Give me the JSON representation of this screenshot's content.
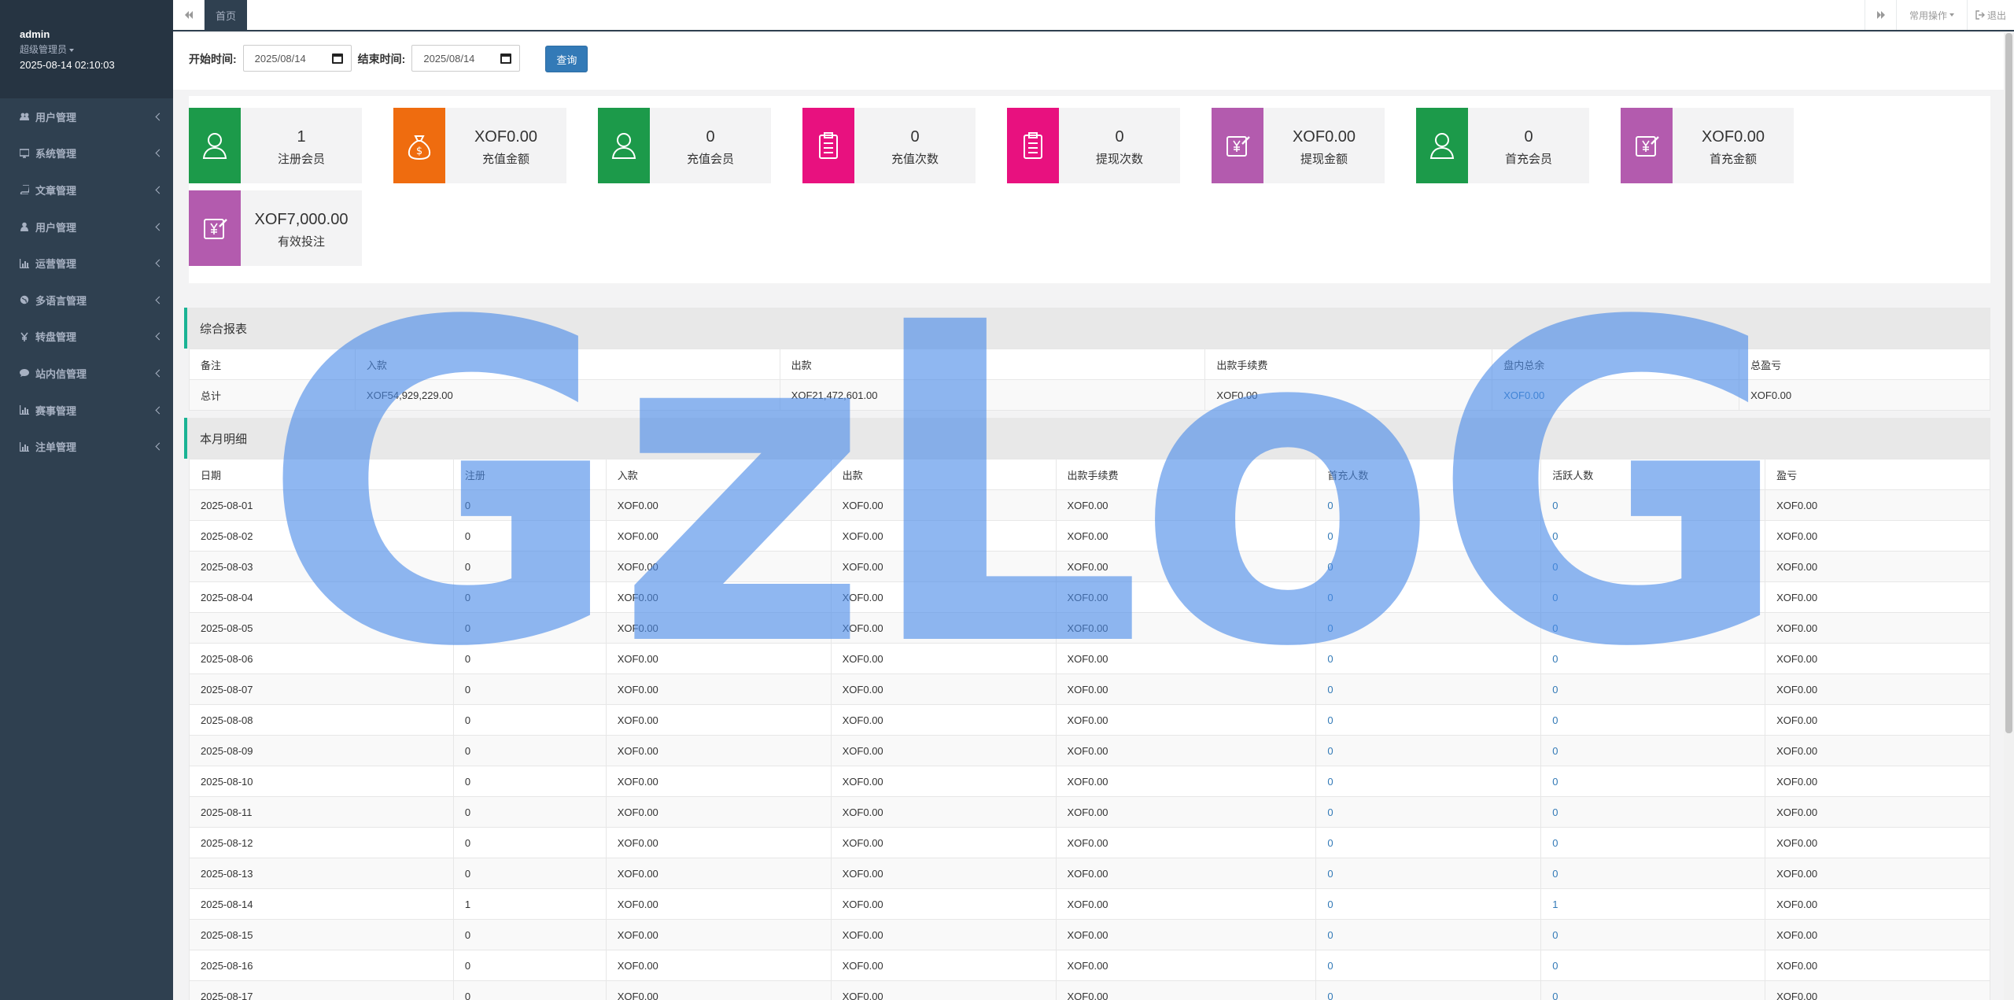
{
  "sidebar": {
    "username": "admin",
    "role": "超级管理员",
    "datetime": "2025-08-14 02:10:03",
    "items": [
      {
        "label": "用户管理",
        "icon": "users-icon"
      },
      {
        "label": "系统管理",
        "icon": "desktop-icon"
      },
      {
        "label": "文章管理",
        "icon": "book-icon"
      },
      {
        "label": "用户管理",
        "icon": "user-icon"
      },
      {
        "label": "运营管理",
        "icon": "bar-chart-icon"
      },
      {
        "label": "多语言管理",
        "icon": "globe-icon"
      },
      {
        "label": "转盘管理",
        "icon": "yen-icon"
      },
      {
        "label": "站内信管理",
        "icon": "comment-icon"
      },
      {
        "label": "赛事管理",
        "icon": "bar-chart-icon"
      },
      {
        "label": "注单管理",
        "icon": "bar-chart-icon"
      }
    ]
  },
  "topbar": {
    "tab_home": "首页",
    "common_ops": "常用操作",
    "logout": "退出"
  },
  "filter": {
    "start_label": "开始时间:",
    "start_value": "2025/08/14",
    "end_label": "结束时间:",
    "end_value": "2025/08/14",
    "query_button": "查询"
  },
  "cards": [
    {
      "value": "1",
      "label": "注册会员",
      "color": "#1c9a4a",
      "icon": "user-icon"
    },
    {
      "value": "XOF0.00",
      "label": "充值金额",
      "color": "#ef6c0f",
      "icon": "money-bag-icon"
    },
    {
      "value": "0",
      "label": "充值会员",
      "color": "#1c9a4a",
      "icon": "user-icon"
    },
    {
      "value": "0",
      "label": "充值次数",
      "color": "#e8117f",
      "icon": "clipboard-icon"
    },
    {
      "value": "0",
      "label": "提现次数",
      "color": "#e8117f",
      "icon": "clipboard-icon"
    },
    {
      "value": "XOF0.00",
      "label": "提现金额",
      "color": "#b35bae",
      "icon": "yen-edit-icon"
    },
    {
      "value": "0",
      "label": "首充会员",
      "color": "#1c9a4a",
      "icon": "user-icon"
    },
    {
      "value": "XOF0.00",
      "label": "首充金额",
      "color": "#b35bae",
      "icon": "yen-edit-icon"
    },
    {
      "value": "XOF7,000.00",
      "label": "有效投注",
      "color": "#b35bae",
      "icon": "yen-edit-icon"
    }
  ],
  "summary": {
    "title": "综合报表",
    "headers": [
      "备注",
      "入款",
      "出款",
      "出款手续费",
      "盘内总余",
      "总盈亏"
    ],
    "row": [
      "总计",
      "XOF54,929,229.00",
      "XOF21,472,601.00",
      "XOF0.00",
      "XOF0.00",
      "XOF0.00"
    ]
  },
  "monthly": {
    "title": "本月明细",
    "headers": [
      "日期",
      "注册",
      "入款",
      "出款",
      "出款手续费",
      "首充人数",
      "活跃人数",
      "盈亏"
    ],
    "rows": [
      [
        "2025-08-01",
        "0",
        "XOF0.00",
        "XOF0.00",
        "XOF0.00",
        "0",
        "0",
        "XOF0.00"
      ],
      [
        "2025-08-02",
        "0",
        "XOF0.00",
        "XOF0.00",
        "XOF0.00",
        "0",
        "0",
        "XOF0.00"
      ],
      [
        "2025-08-03",
        "0",
        "XOF0.00",
        "XOF0.00",
        "XOF0.00",
        "0",
        "0",
        "XOF0.00"
      ],
      [
        "2025-08-04",
        "0",
        "XOF0.00",
        "XOF0.00",
        "XOF0.00",
        "0",
        "0",
        "XOF0.00"
      ],
      [
        "2025-08-05",
        "0",
        "XOF0.00",
        "XOF0.00",
        "XOF0.00",
        "0",
        "0",
        "XOF0.00"
      ],
      [
        "2025-08-06",
        "0",
        "XOF0.00",
        "XOF0.00",
        "XOF0.00",
        "0",
        "0",
        "XOF0.00"
      ],
      [
        "2025-08-07",
        "0",
        "XOF0.00",
        "XOF0.00",
        "XOF0.00",
        "0",
        "0",
        "XOF0.00"
      ],
      [
        "2025-08-08",
        "0",
        "XOF0.00",
        "XOF0.00",
        "XOF0.00",
        "0",
        "0",
        "XOF0.00"
      ],
      [
        "2025-08-09",
        "0",
        "XOF0.00",
        "XOF0.00",
        "XOF0.00",
        "0",
        "0",
        "XOF0.00"
      ],
      [
        "2025-08-10",
        "0",
        "XOF0.00",
        "XOF0.00",
        "XOF0.00",
        "0",
        "0",
        "XOF0.00"
      ],
      [
        "2025-08-11",
        "0",
        "XOF0.00",
        "XOF0.00",
        "XOF0.00",
        "0",
        "0",
        "XOF0.00"
      ],
      [
        "2025-08-12",
        "0",
        "XOF0.00",
        "XOF0.00",
        "XOF0.00",
        "0",
        "0",
        "XOF0.00"
      ],
      [
        "2025-08-13",
        "0",
        "XOF0.00",
        "XOF0.00",
        "XOF0.00",
        "0",
        "0",
        "XOF0.00"
      ],
      [
        "2025-08-14",
        "1",
        "XOF0.00",
        "XOF0.00",
        "XOF0.00",
        "0",
        "1",
        "XOF0.00"
      ],
      [
        "2025-08-15",
        "0",
        "XOF0.00",
        "XOF0.00",
        "XOF0.00",
        "0",
        "0",
        "XOF0.00"
      ],
      [
        "2025-08-16",
        "0",
        "XOF0.00",
        "XOF0.00",
        "XOF0.00",
        "0",
        "0",
        "XOF0.00"
      ],
      [
        "2025-08-17",
        "0",
        "XOF0.00",
        "XOF0.00",
        "XOF0.00",
        "0",
        "0",
        "XOF0.00"
      ]
    ]
  },
  "watermark": {
    "text": "GzLoG",
    "color": "#4a8ae8"
  }
}
